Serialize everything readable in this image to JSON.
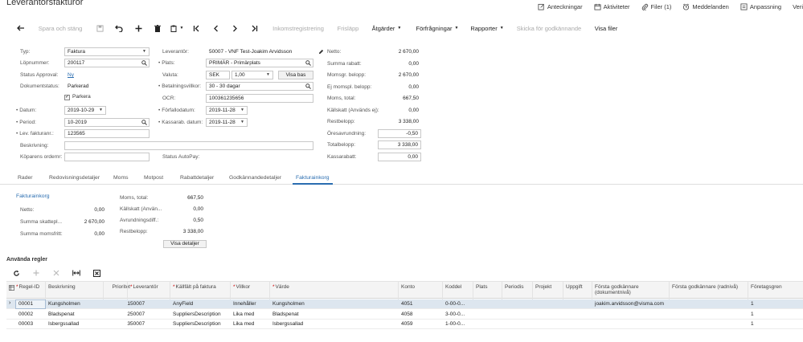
{
  "title": "Leverantörsfakturor",
  "top_actions": [
    "Anteckningar",
    "Aktiviteter",
    "Filer (1)",
    "Meddelanden",
    "Anpassning",
    "Veri"
  ],
  "toolbar": {
    "save_close": "Spara och stäng",
    "incoming_reg": "Inkomstregistrering",
    "release": "Frisläpp",
    "actions": "Åtgärder",
    "inquiries": "Förfrågningar",
    "reports": "Rapporter",
    "send_approval": "Skicka för godkännande",
    "show_files": "Visa filer"
  },
  "form": {
    "typ_label": "Typ:",
    "typ_value": "Faktura",
    "lopnummer_label": "Löpnummer:",
    "lopnummer_value": "200117",
    "status_approval_label": "Status Approval:",
    "status_approval_value": "Ny",
    "dokumentstatus_label": "Dokumentstatus:",
    "dokumentstatus_value": "Parkerad",
    "parkera_label": "Parkera",
    "datum_label": "Datum:",
    "datum_value": "2019-10-29",
    "period_label": "Period:",
    "period_value": "10-2019",
    "lev_fakturanr_label": "Lev. fakturanr.:",
    "lev_fakturanr_value": "123565",
    "beskrivning_label": "Beskrivning:",
    "kopare_label": "Köparens ordernr:",
    "leverantor_label": "Leverantör:",
    "leverantor_value": "50007 - VNF Test-Joakim Arvidsson",
    "plats_label": "Plats:",
    "plats_value": "PRIMÄR - Primärplats",
    "valuta_label": "Valuta:",
    "valuta_value": "SEK",
    "rate_value": "1,00",
    "visa_bas": "Visa bas",
    "betalningsvillkor_label": "Betalningsvillkor:",
    "betalningsvillkor_value": "30 - 30 dagar",
    "ocr_label": "OCR:",
    "ocr_value": "100361235656",
    "forfallodatum_label": "Förfallodatum:",
    "forfallodatum_value": "2019-11-28",
    "kassarab_label": "Kassarab. datum:",
    "kassarab_value": "2019-11-28",
    "status_autopay_label": "Status AutoPay:"
  },
  "summary": [
    {
      "label": "Netto:",
      "value": "2 670,00",
      "boxed": false
    },
    {
      "label": "Summa rabatt:",
      "value": "0,00",
      "boxed": false
    },
    {
      "label": "Momsgr. belopp:",
      "value": "2 670,00",
      "boxed": false
    },
    {
      "label": "Ej momspl. belopp:",
      "value": "0,00",
      "boxed": false
    },
    {
      "label": "Moms, total:",
      "value": "667,50",
      "boxed": false
    },
    {
      "label": "Källskatt (Används ej):",
      "value": "0,00",
      "boxed": false
    },
    {
      "label": "Restbelopp:",
      "value": "3 338,00",
      "boxed": false
    },
    {
      "label": "Öresavrundning:",
      "value": "-0,50",
      "boxed": true
    },
    {
      "label": "Totalbelopp:",
      "value": "3 338,00",
      "boxed": true
    },
    {
      "label": "Kassarabatt:",
      "value": "0,00",
      "boxed": true
    }
  ],
  "tabs": [
    "Rader",
    "Redovisningsdetaljer",
    "Moms",
    "Motpost",
    "Rabattdetaljer",
    "Godkännandedetaljer",
    "Fakturainkorg"
  ],
  "fakturainkorg": {
    "link": "Fakturainkorg",
    "left": [
      {
        "label": "Netto:",
        "value": "0,00"
      },
      {
        "label": "Summa skattepl...",
        "value": "2 670,00"
      },
      {
        "label": "Summa momsfritt:",
        "value": "0,00"
      }
    ],
    "right": [
      {
        "label": "Moms, total:",
        "value": "667,50"
      },
      {
        "label": "Källskatt (Använ...",
        "value": "0,00"
      },
      {
        "label": "Avrundningsdiff.:",
        "value": "0,50"
      },
      {
        "label": "Restbelopp:",
        "value": "3 338,00"
      }
    ],
    "visa_detaljer": "Visa detaljer"
  },
  "rules_title": "Använda regler",
  "grid": {
    "headers": [
      "Regel-ID",
      "Beskrivning",
      "Prioritet",
      "Leverantör",
      "Källfält på faktura",
      "Villkor",
      "Värde",
      "Konto",
      "Koddel",
      "Plats",
      "Periodis",
      "Projekt",
      "Uppgift",
      "Första godkännare (dokumentnivå)",
      "Första godkännare (radnivå)",
      "Företagsgren"
    ],
    "rows": [
      [
        "00001",
        "Kungsholmen",
        "1",
        "50007",
        "AnyField",
        "Innehåller",
        "Kungsholmen",
        "4051",
        "0-00-0...",
        "",
        "",
        "",
        "",
        "joakim.arvidsson@visma.com",
        "",
        "1"
      ],
      [
        "00002",
        "Bladspenat",
        "2",
        "50007",
        "SuppliersDescription",
        "Lika med",
        "Bladspenat",
        "4058",
        "3-00-0...",
        "",
        "",
        "",
        "",
        "",
        "",
        "1"
      ],
      [
        "00003",
        "Isbergssallad",
        "3",
        "50007",
        "SuppliersDescription",
        "Lika med",
        "Isbergssallad",
        "4059",
        "1-00-0...",
        "",
        "",
        "",
        "",
        "",
        "",
        "1"
      ]
    ]
  }
}
